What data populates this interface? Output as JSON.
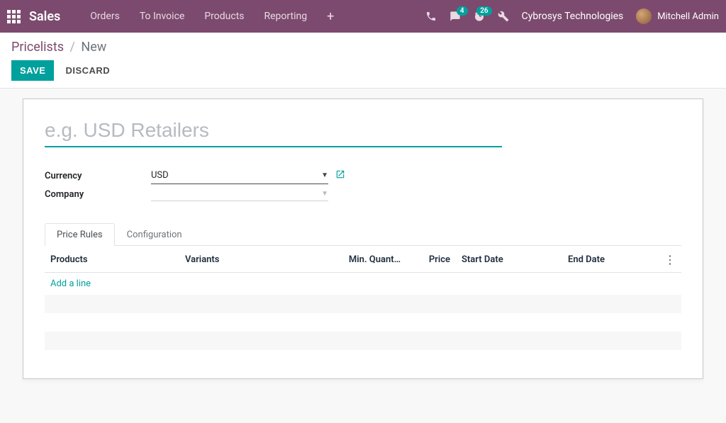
{
  "topnav": {
    "app_title": "Sales",
    "links": [
      "Orders",
      "To Invoice",
      "Products",
      "Reporting"
    ],
    "messages_badge": "4",
    "activities_badge": "26",
    "company": "Cybrosys Technologies",
    "user_name": "Mitchell Admin"
  },
  "breadcrumb": {
    "root": "Pricelists",
    "current": "New"
  },
  "actions": {
    "save": "SAVE",
    "discard": "DISCARD"
  },
  "form": {
    "name_placeholder": "e.g. USD Retailers",
    "name_value": "",
    "currency_label": "Currency",
    "currency_value": "USD",
    "company_label": "Company",
    "company_value": ""
  },
  "tabs": {
    "price_rules": "Price Rules",
    "configuration": "Configuration",
    "active": "price_rules"
  },
  "columns": {
    "products": "Products",
    "variants": "Variants",
    "min_qty": "Min. Quant…",
    "price": "Price",
    "start_date": "Start Date",
    "end_date": "End Date"
  },
  "add_line": "Add a line",
  "rules": []
}
